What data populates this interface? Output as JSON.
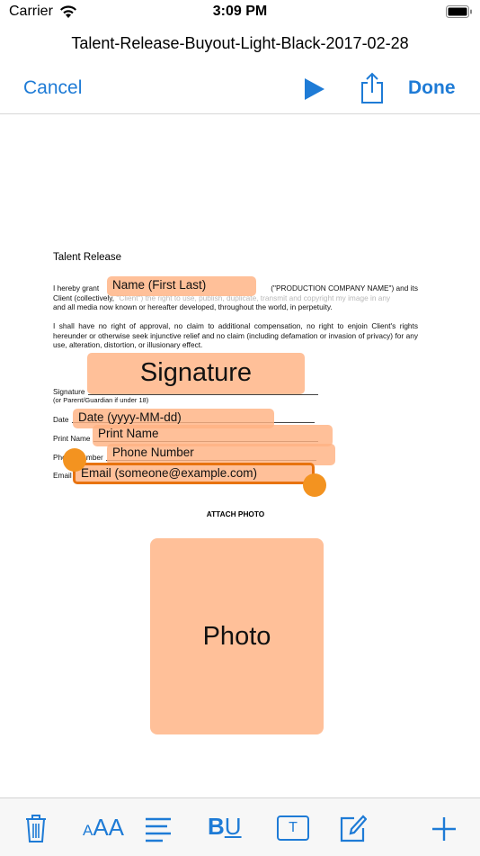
{
  "status_bar": {
    "carrier": "Carrier",
    "time": "3:09 PM"
  },
  "header": {
    "document_title": "Talent-Release-Buyout-Light-Black-2017-02-28"
  },
  "nav": {
    "cancel_label": "Cancel",
    "done_label": "Done",
    "icons": [
      "play-icon",
      "share-icon"
    ]
  },
  "document": {
    "heading": "Talent Release",
    "paragraph1_start": "I hereby grant",
    "paragraph1_rest_line1": "(\"PRODUCTION COMPANY NAME\") and its",
    "paragraph1_client_prefix": "Client (collectively,",
    "paragraph1_client_ref": "\"Client\") the right to use, publish, duplicate, transmit and copyright my image in any",
    "paragraph1_line3": "and all media now known or hereafter developed, throughout the world, in perpetuity.",
    "paragraph2": "I shall have no right of approval, no claim to additional compensation, no right to enjoin Client's rights hereunder or otherwise seek injunctive relief and no claim (including defamation or invasion of privacy) for any use, alteration, distortion, or illusionary effect.",
    "signature_label": "Signature",
    "guardian_note": "(or Parent/Guardian if under 18)",
    "date_label": "Date",
    "print_name_label": "Print Name",
    "phone_label": "Phone Number",
    "email_label": "Email",
    "attach_photo_label": "ATTACH PHOTO"
  },
  "fields": {
    "name": "Name (First Last)",
    "signature": "Signature",
    "date": "Date (yyyy-MM-dd)",
    "print_name": "Print Name",
    "phone": "Phone Number",
    "email": "Email (someone@example.com)",
    "photo": "Photo"
  },
  "toolbar": {
    "font_size_label": "AA",
    "bold_label": "B",
    "underline_label": "U",
    "text_field_label": "T",
    "icons": [
      "trash-icon",
      "font-size-icon",
      "align-icon",
      "bold-underline-icon",
      "text-field-icon",
      "edit-icon",
      "add-icon"
    ]
  },
  "colors": {
    "accent": "#1e7bd6",
    "field_fill": "#ffb282",
    "selection": "#e8730f"
  }
}
